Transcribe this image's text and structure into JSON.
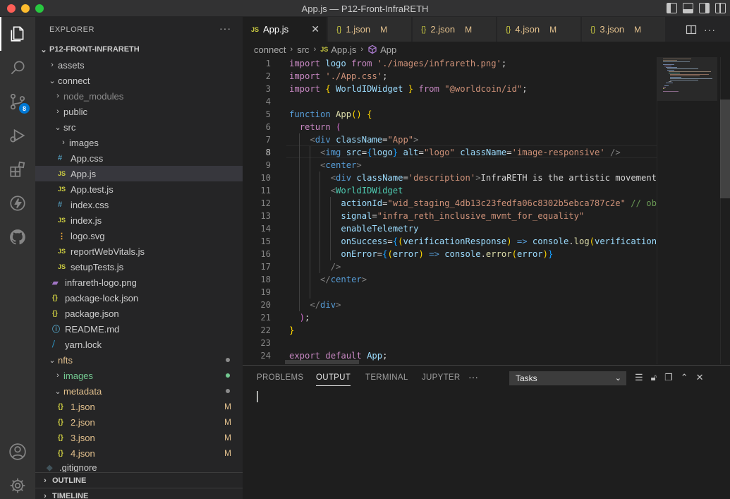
{
  "window": {
    "title": "App.js — P12-Front-InfraRETH"
  },
  "activity": {
    "scm_badge": "8"
  },
  "sidebar": {
    "header": "EXPLORER",
    "more": "···",
    "root": "P12-FRONT-INFRARETH",
    "items": [
      {
        "label": "assets"
      },
      {
        "label": "connect"
      },
      {
        "label": "node_modules"
      },
      {
        "label": "public"
      },
      {
        "label": "src"
      },
      {
        "label": "images"
      },
      {
        "label": "App.css"
      },
      {
        "label": "App.js"
      },
      {
        "label": "App.test.js"
      },
      {
        "label": "index.css"
      },
      {
        "label": "index.js"
      },
      {
        "label": "logo.svg"
      },
      {
        "label": "reportWebVitals.js"
      },
      {
        "label": "setupTests.js"
      },
      {
        "label": "infrareth-logo.png"
      },
      {
        "label": "package-lock.json"
      },
      {
        "label": "package.json"
      },
      {
        "label": "README.md"
      },
      {
        "label": "yarn.lock"
      },
      {
        "label": "nfts"
      },
      {
        "label": "images"
      },
      {
        "label": "metadata"
      },
      {
        "label": "1.json",
        "status": "M"
      },
      {
        "label": "2.json",
        "status": "M"
      },
      {
        "label": "3.json",
        "status": "M"
      },
      {
        "label": "4.json",
        "status": "M"
      },
      {
        "label": ".gitignore"
      }
    ],
    "outline": "OUTLINE",
    "timeline": "TIMELINE"
  },
  "tabs": [
    {
      "label": "App.js",
      "icon": "JS"
    },
    {
      "label": "1.json",
      "icon": "{}",
      "status": "M"
    },
    {
      "label": "2.json",
      "icon": "{}",
      "status": "M"
    },
    {
      "label": "4.json",
      "icon": "{}",
      "status": "M"
    },
    {
      "label": "3.json",
      "icon": "{}",
      "status": "M"
    }
  ],
  "breadcrumb": [
    "connect",
    "src",
    "App.js",
    "App"
  ],
  "editor": {
    "line_numbers": [
      "1",
      "2",
      "3",
      "4",
      "5",
      "6",
      "7",
      "8",
      "9",
      "10",
      "11",
      "12",
      "13",
      "14",
      "15",
      "16",
      "17",
      "18",
      "19",
      "20",
      "21",
      "22",
      "23",
      "24"
    ],
    "current_line": "8"
  },
  "panel": {
    "tabs": [
      "PROBLEMS",
      "OUTPUT",
      "TERMINAL",
      "JUPYTER"
    ],
    "more": "···",
    "task_select": "Tasks"
  }
}
